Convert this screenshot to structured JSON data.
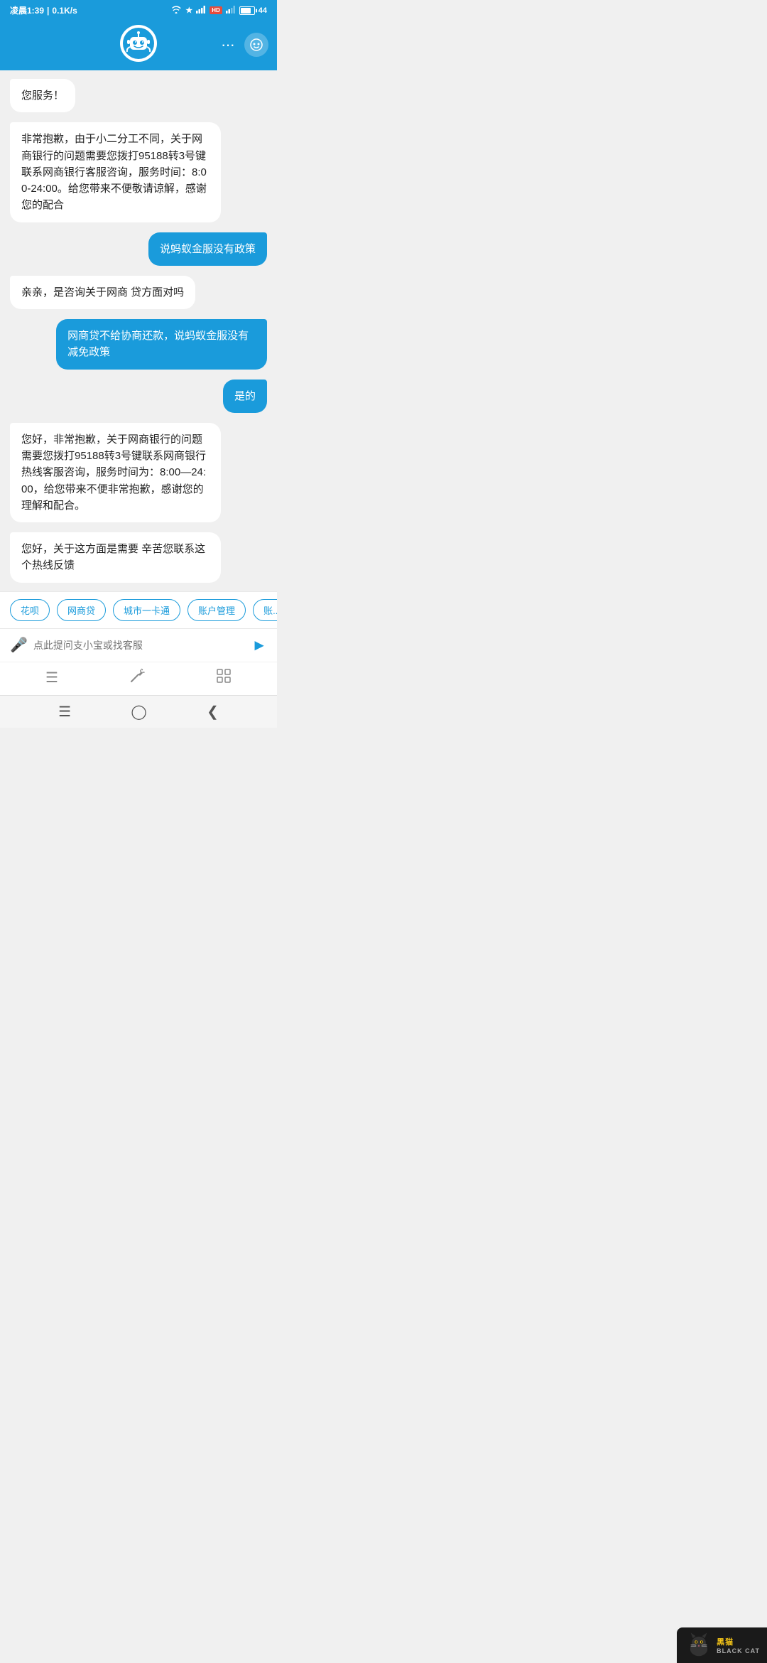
{
  "status_bar": {
    "time": "凌晨1:39",
    "speed": "0.1K/s",
    "battery_level": 44
  },
  "header": {
    "more_label": "···",
    "face_icon": "😊"
  },
  "messages": [
    {
      "id": 1,
      "side": "left",
      "text": "您服务！"
    },
    {
      "id": 2,
      "side": "left",
      "text": "非常抱歉，由于小二分工不同，关于网商银行的问题需要您拨打95188转3号键联系网商银行客服咨询，服务时间：8:00-24:00。给您带来不便敬请谅解，感谢您的配合"
    },
    {
      "id": 3,
      "side": "right",
      "text": "说蚂蚁金服没有政策"
    },
    {
      "id": 4,
      "side": "left",
      "text": "亲亲，是咨询关于网商 贷方面对吗"
    },
    {
      "id": 5,
      "side": "right",
      "text": "网商贷不给协商还款，说蚂蚁金服没有减免政策"
    },
    {
      "id": 6,
      "side": "right",
      "text": "是的"
    },
    {
      "id": 7,
      "side": "left",
      "text": "您好，非常抱歉，关于网商银行的问题需要您拨打95188转3号键联系网商银行热线客服咨询，服务时间为：8:00—24:00，给您带来不便非常抱歉，感谢您的理解和配合。"
    },
    {
      "id": 8,
      "side": "left",
      "text": "您好，关于这方面是需要 辛苦您联系这个热线反馈"
    }
  ],
  "chips": [
    {
      "id": 1,
      "label": "花呗"
    },
    {
      "id": 2,
      "label": "网商贷"
    },
    {
      "id": 3,
      "label": "城市一卡通"
    },
    {
      "id": 4,
      "label": "账户管理"
    },
    {
      "id": 5,
      "label": "账..."
    }
  ],
  "input": {
    "placeholder": "点此提问支小宝或找客服"
  },
  "toolbar": {
    "wand_icon": "✨",
    "grid_icon": "⊞"
  },
  "watermark": {
    "brand": "黑猫",
    "brand_en": "BLACK CAT"
  }
}
